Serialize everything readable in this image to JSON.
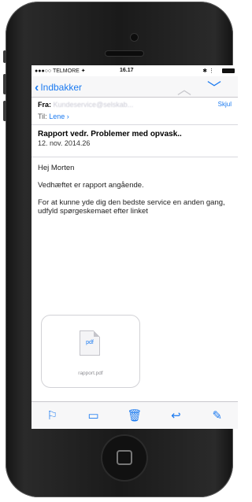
{
  "status": {
    "carrier": "●●●○○ TELMORE ✦",
    "time": "16.17",
    "lock": "✱ ⋮"
  },
  "nav": {
    "back_label": "Indbakker"
  },
  "header": {
    "from_label": "Fra:",
    "from_value": "Kundeservice@selskab...",
    "hide_label": "Skjul",
    "to_label": "Til:",
    "to_value": "Lene"
  },
  "message": {
    "subject": "Rapport vedr. Problemer med opvask..",
    "date": "12. nov. 2014.26",
    "greeting": "Hej Morten",
    "para1": "Vedhæftet er rapport angående.",
    "para2": "For at kunne yde dig den bedste service en anden gang, udfyld spørgeskemaet efter linket"
  },
  "attachment": {
    "type": "pdf",
    "filename": "rapport.pdf"
  },
  "colors": {
    "accent": "#1b7af0"
  },
  "icons": [
    "flag-icon",
    "folder-icon",
    "trash-icon",
    "reply-icon",
    "compose-icon"
  ]
}
